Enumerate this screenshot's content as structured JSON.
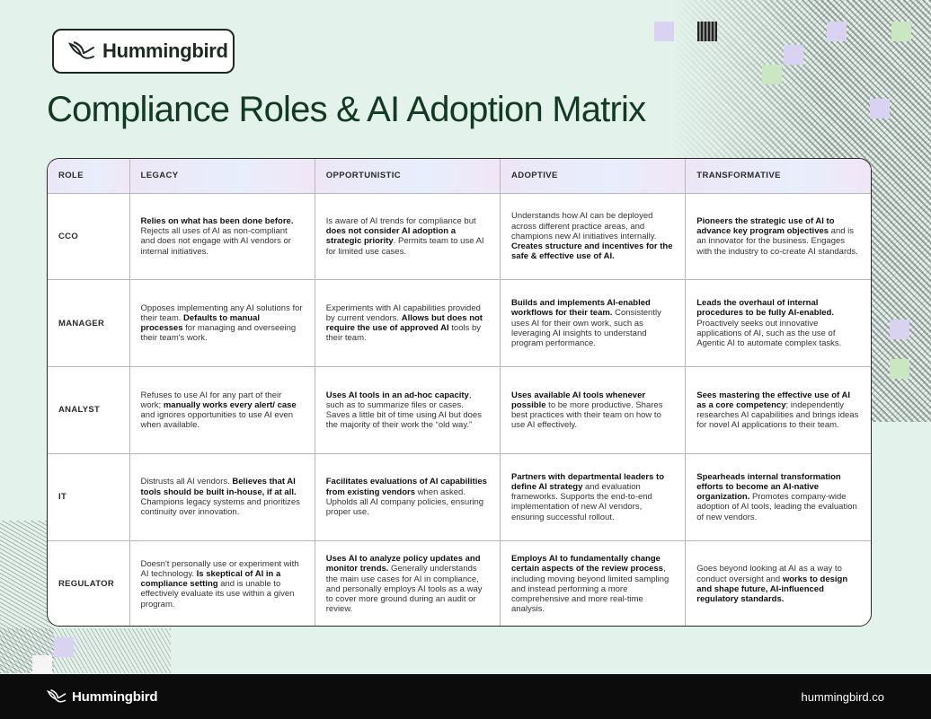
{
  "brand": {
    "name": "Hummingbird",
    "logo_icon": "hummingbird-icon"
  },
  "title": "Compliance Roles & AI Adoption Matrix",
  "headers": [
    "ROLE",
    "LEGACY",
    "OPPORTUNISTIC",
    "ADOPTIVE",
    "TRANSFORMATIVE"
  ],
  "rows": [
    {
      "role": "CCO",
      "cells": [
        [
          {
            "b": "Relies on what has been done before."
          },
          {
            "t": " Rejects all uses of AI as non-compliant and does not engage with AI vendors or internal initiatives."
          }
        ],
        [
          {
            "t": "Is aware of AI trends for compliance but "
          },
          {
            "b": "does not consider AI adoption a strategic priority"
          },
          {
            "t": ". Permits team to use AI for limited use cases."
          }
        ],
        [
          {
            "t": "Understands how AI can be deployed across different practice areas, and champions new AI initiatives internally. "
          },
          {
            "b": "Creates structure and incentives for the safe & effective use of AI."
          }
        ],
        [
          {
            "b": "Pioneers the strategic use of AI to advance key program objectives"
          },
          {
            "t": " and is an innovator for the business. Engages with the industry to co-create AI standards."
          }
        ]
      ]
    },
    {
      "role": "MANAGER",
      "cells": [
        [
          {
            "t": "Opposes implementing any AI solutions for their team. "
          },
          {
            "b": "Defaults to manual processes"
          },
          {
            "t": " for managing and overseeing their team's work."
          }
        ],
        [
          {
            "t": "Experiments with AI capabilities provided by current vendors. "
          },
          {
            "b": "Allows but does not require the use of approved AI"
          },
          {
            "t": " tools by their team."
          }
        ],
        [
          {
            "b": "Builds and implements AI-enabled workflows for their team."
          },
          {
            "t": " Consistently uses AI for their own work, such as leveraging AI insights to understand program performance."
          }
        ],
        [
          {
            "b": "Leads the overhaul of internal procedures to be fully AI-enabled."
          },
          {
            "t": " Proactively seeks out innovative applications of AI, such as the use of Agentic AI to automate complex tasks."
          }
        ]
      ]
    },
    {
      "role": "ANALYST",
      "cells": [
        [
          {
            "t": "Refuses to use AI for any part of their work; "
          },
          {
            "b": "manually works every alert/ case"
          },
          {
            "t": " and ignores opportunities to use AI even when available."
          }
        ],
        [
          {
            "b": "Uses AI tools in an ad-hoc capacity"
          },
          {
            "t": ", such as to summarize files or cases. Saves a little bit of time using AI but does the majority of their work the “old way.”"
          }
        ],
        [
          {
            "b": "Uses available AI tools whenever possible"
          },
          {
            "t": " to be more productive. Shares best practices with their team on how to use AI effectively."
          }
        ],
        [
          {
            "b": "Sees mastering the effective use of AI as a core competency"
          },
          {
            "t": "; independently researches AI capabilities and brings ideas for novel AI applications to their team."
          }
        ]
      ]
    },
    {
      "role": "IT",
      "cells": [
        [
          {
            "t": "Distrusts all AI vendors. "
          },
          {
            "b": "Believes that AI tools should be built in-house, if at all."
          },
          {
            "t": " Champions legacy systems and prioritizes continuity over innovation."
          }
        ],
        [
          {
            "b": "Facilitates evaluations of AI capabilities from existing vendors"
          },
          {
            "t": " when asked. Upholds all AI company policies, ensuring proper use."
          }
        ],
        [
          {
            "b": "Partners with departmental leaders to define AI strategy"
          },
          {
            "t": " and evaluation frameworks. Supports the end-to-end implementation of new AI vendors, ensuring successful rollout."
          }
        ],
        [
          {
            "b": "Spearheads internal transformation efforts to become an AI-native organization."
          },
          {
            "t": " Promotes company-wide adoption of AI tools, leading the evaluation of new vendors."
          }
        ]
      ]
    },
    {
      "role": "REGULATOR",
      "cells": [
        [
          {
            "t": "Doesn't personally use or experiment with AI technology. "
          },
          {
            "b": "Is skeptical of AI in a compliance setting"
          },
          {
            "t": " and is unable to effectively evaluate its use within a given program."
          }
        ],
        [
          {
            "b": "Uses AI to analyze policy updates and monitor trends."
          },
          {
            "t": " Generally understands the main use cases for AI in compliance, and personally employs AI tools as a way to cover more ground during an audit or review."
          }
        ],
        [
          {
            "b": "Employs AI to fundamentally change certain aspects of the review process"
          },
          {
            "t": ", including moving beyond limited sampling and instead performing a more comprehensive and more real-time analysis."
          }
        ],
        [
          {
            "t": "Goes beyond looking at AI as a way to conduct oversight and "
          },
          {
            "b": "works to design and shape future, AI-influenced regulatory standards."
          }
        ]
      ]
    }
  ],
  "footer": {
    "brand": "Hummingbird",
    "url": "hummingbird.co"
  },
  "colors": {
    "background": "#e4f2ec",
    "title": "#123a22",
    "header_band": "#ece6f6",
    "footer": "#0c0c0c"
  }
}
